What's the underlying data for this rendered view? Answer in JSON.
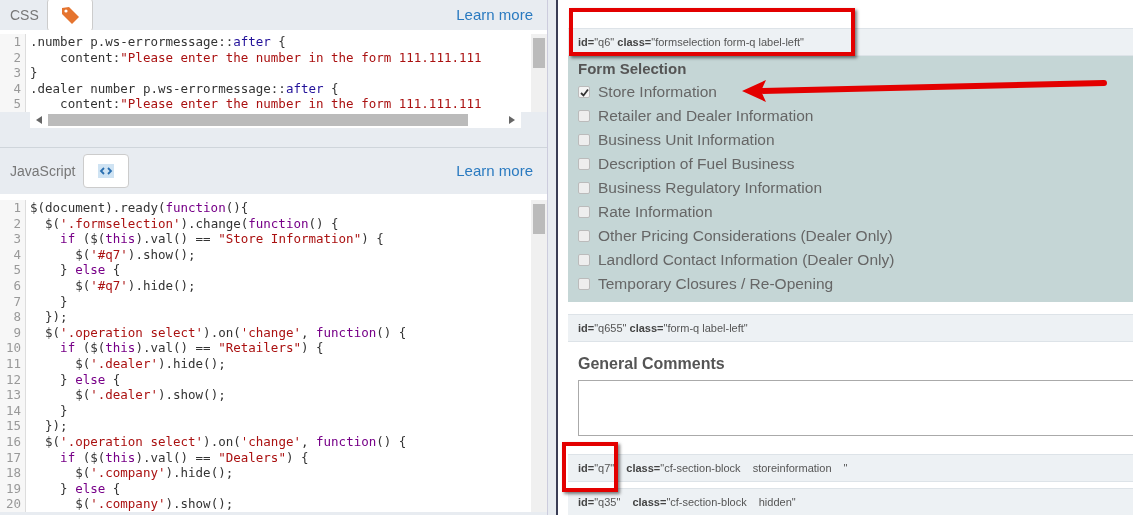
{
  "css_panel": {
    "title": "CSS",
    "learn_more": "Learn more",
    "lines": [
      {
        "number": "1",
        "tokens": [
          {
            "kind": "plain",
            "text": ".number p.ws-errormessage::"
          },
          {
            "kind": "atom",
            "text": "after"
          },
          {
            "kind": "plain",
            "text": " {"
          }
        ]
      },
      {
        "number": "2",
        "tokens": [
          {
            "kind": "plain",
            "text": "    content:"
          },
          {
            "kind": "string",
            "text": "\"Please enter the number in the form 111.111.111"
          }
        ]
      },
      {
        "number": "3",
        "tokens": [
          {
            "kind": "plain",
            "text": "}"
          }
        ]
      },
      {
        "number": "4",
        "tokens": [
          {
            "kind": "plain",
            "text": ".dealer number p.ws-errormessage::"
          },
          {
            "kind": "atom",
            "text": "after"
          },
          {
            "kind": "plain",
            "text": " {"
          }
        ]
      },
      {
        "number": "5",
        "tokens": [
          {
            "kind": "plain",
            "text": "    content:"
          },
          {
            "kind": "string",
            "text": "\"Please enter the number in the form 111.111.111"
          }
        ]
      }
    ]
  },
  "js_panel": {
    "title": "JavaScript",
    "learn_more": "Learn more",
    "lines": [
      {
        "number": "1",
        "tokens": [
          {
            "kind": "plain",
            "text": "$(document).ready("
          },
          {
            "kind": "keyword",
            "text": "function"
          },
          {
            "kind": "plain",
            "text": "(){"
          }
        ]
      },
      {
        "number": "2",
        "tokens": [
          {
            "kind": "plain",
            "text": "  $("
          },
          {
            "kind": "string",
            "text": "'.formselection'"
          },
          {
            "kind": "plain",
            "text": ").change("
          },
          {
            "kind": "keyword",
            "text": "function"
          },
          {
            "kind": "plain",
            "text": "() {"
          }
        ]
      },
      {
        "number": "3",
        "tokens": [
          {
            "kind": "keyword",
            "text": "    if"
          },
          {
            "kind": "plain",
            "text": " ($("
          },
          {
            "kind": "keyword",
            "text": "this"
          },
          {
            "kind": "plain",
            "text": ").val() == "
          },
          {
            "kind": "string",
            "text": "\"Store Information\""
          },
          {
            "kind": "plain",
            "text": ") {"
          }
        ]
      },
      {
        "number": "4",
        "tokens": [
          {
            "kind": "plain",
            "text": "      $("
          },
          {
            "kind": "string",
            "text": "'#q7'"
          },
          {
            "kind": "plain",
            "text": ").show();"
          }
        ]
      },
      {
        "number": "5",
        "tokens": [
          {
            "kind": "plain",
            "text": "    } "
          },
          {
            "kind": "keyword",
            "text": "else"
          },
          {
            "kind": "plain",
            "text": " {"
          }
        ]
      },
      {
        "number": "6",
        "tokens": [
          {
            "kind": "plain",
            "text": "      $("
          },
          {
            "kind": "string",
            "text": "'#q7'"
          },
          {
            "kind": "plain",
            "text": ").hide();"
          }
        ]
      },
      {
        "number": "7",
        "tokens": [
          {
            "kind": "plain",
            "text": "    }"
          }
        ]
      },
      {
        "number": "8",
        "tokens": [
          {
            "kind": "plain",
            "text": "  });"
          }
        ]
      },
      {
        "number": "9",
        "tokens": [
          {
            "kind": "plain",
            "text": "  $("
          },
          {
            "kind": "string",
            "text": "'.operation select'"
          },
          {
            "kind": "plain",
            "text": ").on("
          },
          {
            "kind": "string",
            "text": "'change'"
          },
          {
            "kind": "plain",
            "text": ", "
          },
          {
            "kind": "keyword",
            "text": "function"
          },
          {
            "kind": "plain",
            "text": "() {"
          }
        ]
      },
      {
        "number": "10",
        "tokens": [
          {
            "kind": "keyword",
            "text": "    if"
          },
          {
            "kind": "plain",
            "text": " ($("
          },
          {
            "kind": "keyword",
            "text": "this"
          },
          {
            "kind": "plain",
            "text": ").val() == "
          },
          {
            "kind": "string",
            "text": "\"Retailers\""
          },
          {
            "kind": "plain",
            "text": ") {"
          }
        ]
      },
      {
        "number": "11",
        "tokens": [
          {
            "kind": "plain",
            "text": "      $("
          },
          {
            "kind": "string",
            "text": "'.dealer'"
          },
          {
            "kind": "plain",
            "text": ").hide();"
          }
        ]
      },
      {
        "number": "12",
        "tokens": [
          {
            "kind": "plain",
            "text": "    } "
          },
          {
            "kind": "keyword",
            "text": "else"
          },
          {
            "kind": "plain",
            "text": " {"
          }
        ]
      },
      {
        "number": "13",
        "tokens": [
          {
            "kind": "plain",
            "text": "      $("
          },
          {
            "kind": "string",
            "text": "'.dealer'"
          },
          {
            "kind": "plain",
            "text": ").show();"
          }
        ]
      },
      {
        "number": "14",
        "tokens": [
          {
            "kind": "plain",
            "text": "    }"
          }
        ]
      },
      {
        "number": "15",
        "tokens": [
          {
            "kind": "plain",
            "text": "  });"
          }
        ]
      },
      {
        "number": "16",
        "tokens": [
          {
            "kind": "plain",
            "text": "  $("
          },
          {
            "kind": "string",
            "text": "'.operation select'"
          },
          {
            "kind": "plain",
            "text": ").on("
          },
          {
            "kind": "string",
            "text": "'change'"
          },
          {
            "kind": "plain",
            "text": ", "
          },
          {
            "kind": "keyword",
            "text": "function"
          },
          {
            "kind": "plain",
            "text": "() {"
          }
        ]
      },
      {
        "number": "17",
        "tokens": [
          {
            "kind": "keyword",
            "text": "    if"
          },
          {
            "kind": "plain",
            "text": " ($("
          },
          {
            "kind": "keyword",
            "text": "this"
          },
          {
            "kind": "plain",
            "text": ").val() == "
          },
          {
            "kind": "string",
            "text": "\"Dealers\""
          },
          {
            "kind": "plain",
            "text": ") {"
          }
        ]
      },
      {
        "number": "18",
        "tokens": [
          {
            "kind": "plain",
            "text": "      $("
          },
          {
            "kind": "string",
            "text": "'.company'"
          },
          {
            "kind": "plain",
            "text": ").hide();"
          }
        ]
      },
      {
        "number": "19",
        "tokens": [
          {
            "kind": "plain",
            "text": "    } "
          },
          {
            "kind": "keyword",
            "text": "else"
          },
          {
            "kind": "plain",
            "text": " {"
          }
        ]
      },
      {
        "number": "20",
        "tokens": [
          {
            "kind": "plain",
            "text": "      $("
          },
          {
            "kind": "string",
            "text": "'.company'"
          },
          {
            "kind": "plain",
            "text": ").show();"
          }
        ]
      }
    ]
  },
  "preview": {
    "form_selection": {
      "tag": "**id=**\"q6\" **class=**\"formselection form-q label-left\"",
      "heading": "Form Selection",
      "options": [
        {
          "label": "Store Information",
          "checked": true
        },
        {
          "label": "Retailer and Dealer Information",
          "checked": false
        },
        {
          "label": "Business Unit Information",
          "checked": false
        },
        {
          "label": "Description of Fuel Business",
          "checked": false
        },
        {
          "label": "Business Regulatory Information",
          "checked": false
        },
        {
          "label": "Rate Information",
          "checked": false
        },
        {
          "label": "Other Pricing Considerations (Dealer Only)",
          "checked": false
        },
        {
          "label": "Landlord Contact Information (Dealer Only)",
          "checked": false
        },
        {
          "label": "Temporary Closures / Re-Opening",
          "checked": false
        }
      ]
    },
    "comments": {
      "tag": "**id=**\"q655\" **class=**\"form-q label-left\"",
      "heading": "General Comments"
    },
    "section_tags": [
      "**id=**\"q7\" **class=**\"cf-section-block storeinformation \"",
      "**id=**\"q35\" **class=**\"cf-section-block hidden\""
    ]
  }
}
